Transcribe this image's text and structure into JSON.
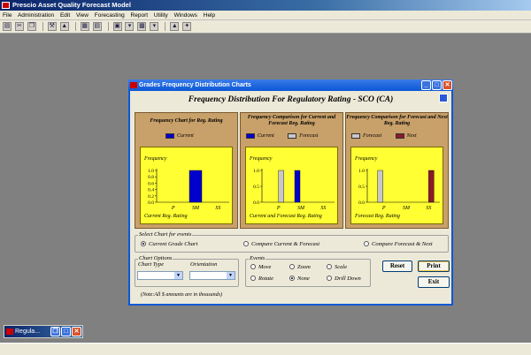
{
  "app": {
    "title": "Prescio Asset Quality Forecast Model",
    "menu": [
      "File",
      "Administration",
      "Edit",
      "View",
      "Forecasting",
      "Report",
      "Utility",
      "Windows",
      "Help"
    ]
  },
  "minimized": {
    "title": "Regula..."
  },
  "dialog": {
    "title": "Grades Frequency Distribution Charts",
    "heading": "Frequency Distribution For Regulatory Rating - SCO (CA)",
    "note": "(Note:All $ amounts are in thousands)",
    "select_group": {
      "label": "Select Chart for events",
      "options": [
        "Current Grade Chart",
        "Compare Current & Forecast",
        "Compare Forecast & Next"
      ],
      "selected": 0
    },
    "chart_options": {
      "label": "Chart Options",
      "chart_type_label": "Chart Type",
      "orientation_label": "Orientation"
    },
    "events": {
      "label": "Events",
      "options": [
        "Move",
        "Zoom",
        "Scale",
        "Rotate",
        "None",
        "Drill Down"
      ],
      "selected": 4
    },
    "buttons": {
      "reset": "Reset",
      "print": "Print",
      "exit": "Exit"
    }
  },
  "chart_data": [
    {
      "type": "bar",
      "title": "Frequency Chart for Reg. Rating",
      "ylabel": "Frequency",
      "xlabel": "Current Reg. Rating",
      "categories": [
        "P",
        "SM",
        "SS"
      ],
      "ylim": [
        0,
        1
      ],
      "yticks": [
        "0.0",
        "0.2",
        "0.4",
        "0.6",
        "0.8",
        "1.0"
      ],
      "series": [
        {
          "name": "Current",
          "color": "#0000cc",
          "values": [
            0,
            1,
            0
          ]
        }
      ]
    },
    {
      "type": "bar",
      "title": "Frequency Comparison for Current and Forecast Reg. Rating",
      "ylabel": "Frequency",
      "xlabel": "Current and Forecast Reg. Rating",
      "categories": [
        "P",
        "SM",
        "SS"
      ],
      "ylim": [
        0,
        1
      ],
      "yticks": [
        "0.0",
        "0.5",
        "1.0"
      ],
      "series": [
        {
          "name": "Current",
          "color": "#0000cc",
          "values": [
            0,
            1,
            0
          ]
        },
        {
          "name": "Forecast",
          "color": "#c8c8c8",
          "values": [
            1,
            0,
            0
          ]
        }
      ]
    },
    {
      "type": "bar",
      "title": "Frequency Comparison for Forecast and Next Reg. Rating",
      "ylabel": "Frequency",
      "xlabel": "Forecast Reg. Rating",
      "categories": [
        "P",
        "SM",
        "SS"
      ],
      "ylim": [
        0,
        1
      ],
      "yticks": [
        "0.0",
        "0.5",
        "1.0"
      ],
      "series": [
        {
          "name": "Forecast",
          "color": "#c8c8c8",
          "values": [
            1,
            0,
            0
          ]
        },
        {
          "name": "Next",
          "color": "#8b1a2a",
          "values": [
            0,
            0,
            1
          ]
        }
      ]
    }
  ]
}
